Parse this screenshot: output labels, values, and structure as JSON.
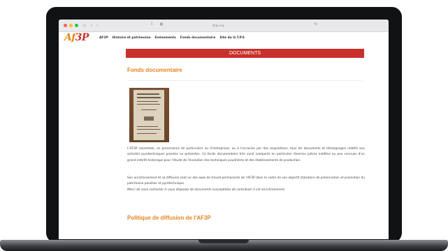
{
  "browser": {
    "url": "af3p.org"
  },
  "nav": {
    "logo_prefix": "Af",
    "logo_highlight": "3P",
    "links": [
      "AF3P",
      "Histoire et patrimoine",
      "Evénements",
      "Fonds documentaire",
      "Site du G.T.P.S"
    ]
  },
  "banner": {
    "label": "DOCUMENTS"
  },
  "section1": {
    "title": "Fonds documentaire",
    "para1": "L'AF3P rassemble, en provenance de particuliers ou d'entreprises, ou à l'occasion par des acquisitions, tous les documents et témoignages relatifs aux activités pyrotechniques passées ou présentes. Ce fonds documentaire très varié comporte en particulier diverses pièces inédites ou peu connues d'un grand intérêt historique pour l'étude de l'évolution des techniques poudrières et des établissements de production.",
    "para2": "Son enrichissement et sa diffusion sont un des axes de travail permanents de l'AF3P dans le cadre de son objectif statutaire de préservation et promotion du patrimoine poudrier et pyrotechnique.",
    "para3": "Merci de nous contacter si vous disposez de documents susceptibles de contribuer à cet enrichissement."
  },
  "section2": {
    "title": "Politique de diffusion de l'AF3P"
  }
}
